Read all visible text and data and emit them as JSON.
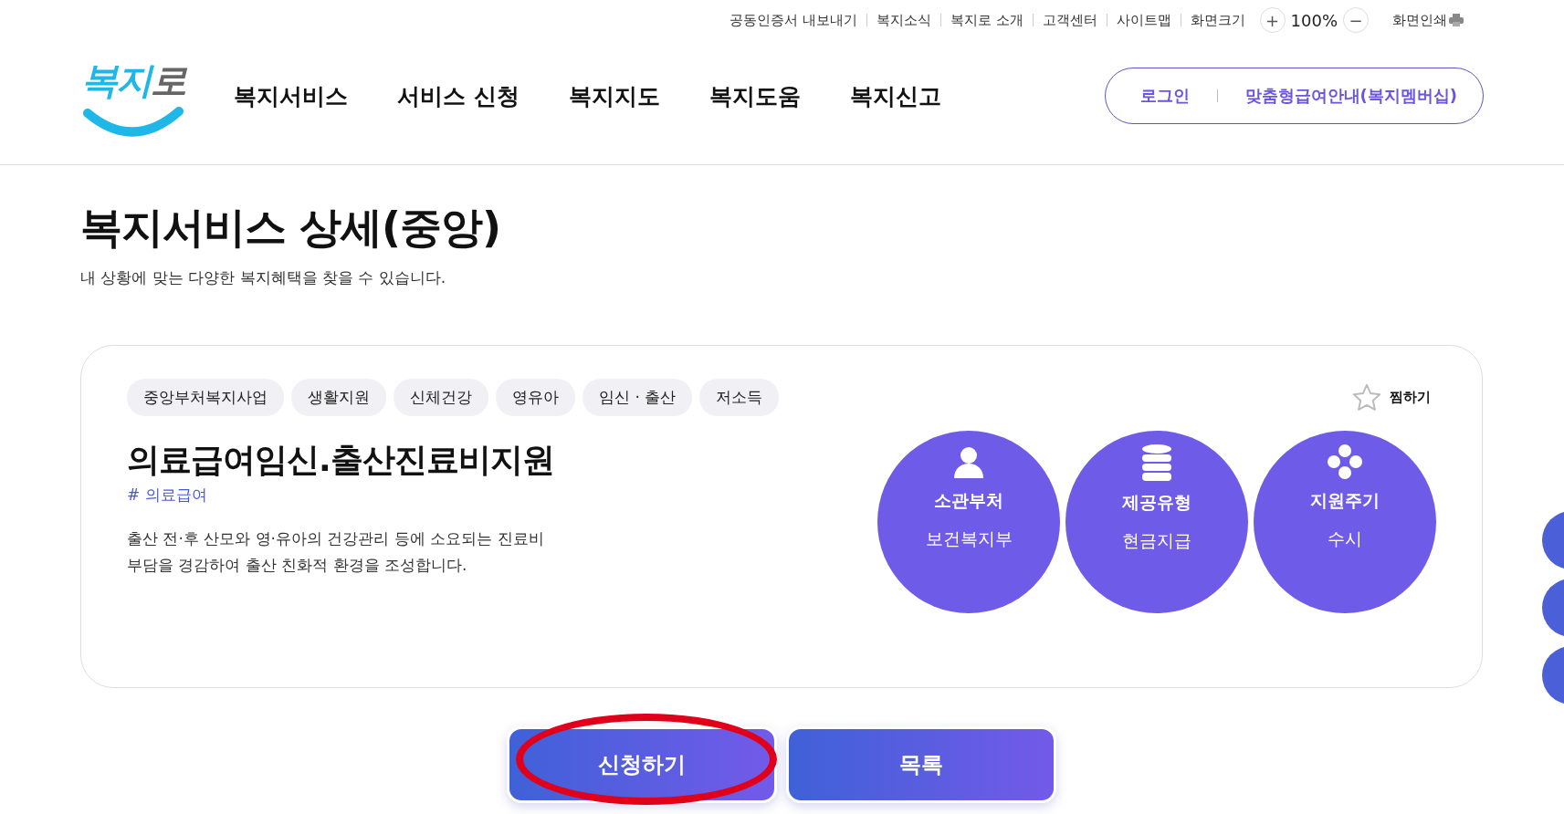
{
  "utility_links": [
    "공동인증서 내보내기",
    "복지소식",
    "복지로 소개",
    "고객센터",
    "사이트맵",
    "화면크기"
  ],
  "zoom": {
    "plus": "+",
    "value": "100%",
    "minus": "−"
  },
  "print": "화면인쇄",
  "logo": {
    "parts": [
      "복지",
      "로"
    ]
  },
  "nav": [
    "복지서비스",
    "서비스 신청",
    "복지지도",
    "복지도움",
    "복지신고"
  ],
  "account": {
    "login": "로그인",
    "membership": "맞춤형급여안내(복지멤버십)"
  },
  "page": {
    "title": "복지서비스 상세(중앙)",
    "subtitle": "내 상황에 맞는 다양한 복지혜택을 찾을 수 있습니다."
  },
  "service": {
    "tags": [
      "중앙부처복지사업",
      "생활지원",
      "신체건강",
      "영유아",
      "임신 · 출산",
      "저소득"
    ],
    "favorite": {
      "label": "찜하기",
      "selected": false
    },
    "name": "의료급여임신.출산진료비지원",
    "category": "# 의료급여",
    "description": "출산 전·후 산모와 영·유아의 건강관리 등에 소요되는 진료비 부담을 경감하여 출산 친화적 환경을 조성합니다.",
    "facts": [
      {
        "kind": "person",
        "label": "소관부처",
        "value": "보건복지부"
      },
      {
        "kind": "database",
        "label": "제공유형",
        "value": "현금지급"
      },
      {
        "kind": "dots",
        "label": "지원주기",
        "value": "수시"
      }
    ]
  },
  "actions": [
    {
      "label": "신청하기",
      "highlighted": true
    },
    {
      "label": "목록",
      "highlighted": false
    }
  ],
  "quick_menu": [
    {
      "kind": "button"
    },
    {
      "kind": "button"
    },
    {
      "kind": "button"
    }
  ]
}
